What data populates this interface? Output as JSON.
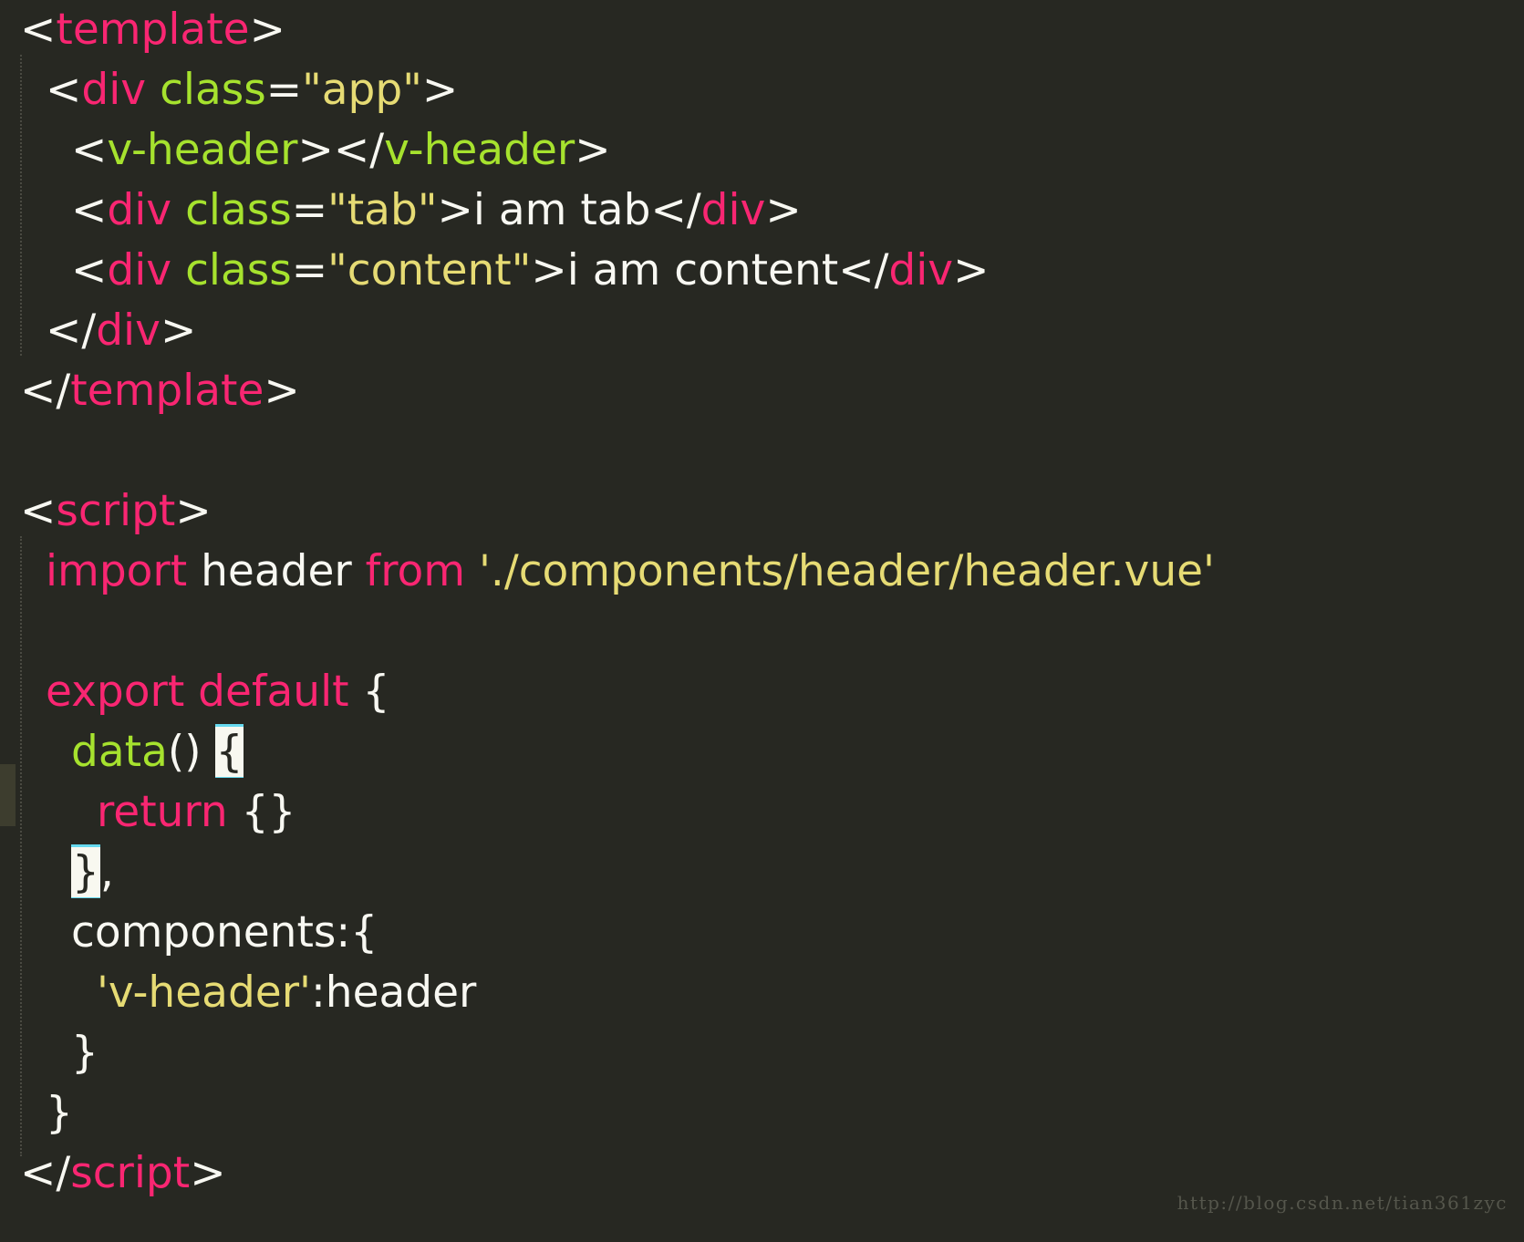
{
  "editor": {
    "theme_name": "monokai",
    "language": "vue",
    "background_color": "#272822",
    "foreground_color": "#f8f8f2",
    "tag_color": "#f92672",
    "attr_color": "#a6e22e",
    "string_color": "#e6db74",
    "bracket_highlight_color": "#f8f8f0",
    "bracket_highlight_border_color": "#66d9ef",
    "indent_guide_color": "#4a4a42",
    "marker_bar_color": "#3d3d2e"
  },
  "code_lines": [
    {
      "indent": 0,
      "tokens": [
        {
          "t": "<",
          "c": "punc"
        },
        {
          "t": "template",
          "c": "tag"
        },
        {
          "t": ">",
          "c": "punc"
        }
      ]
    },
    {
      "indent": 1,
      "tokens": [
        {
          "t": "<",
          "c": "punc"
        },
        {
          "t": "div",
          "c": "tag"
        },
        {
          "t": " ",
          "c": "text"
        },
        {
          "t": "class",
          "c": "attr"
        },
        {
          "t": "=",
          "c": "punc"
        },
        {
          "t": "\"app\"",
          "c": "str"
        },
        {
          "t": ">",
          "c": "punc"
        }
      ]
    },
    {
      "indent": 2,
      "tokens": [
        {
          "t": "<",
          "c": "punc"
        },
        {
          "t": "v-header",
          "c": "attr"
        },
        {
          "t": ">",
          "c": "punc"
        },
        {
          "t": "</",
          "c": "punc"
        },
        {
          "t": "v-header",
          "c": "attr"
        },
        {
          "t": ">",
          "c": "punc"
        }
      ]
    },
    {
      "indent": 2,
      "tokens": [
        {
          "t": "<",
          "c": "punc"
        },
        {
          "t": "div",
          "c": "tag"
        },
        {
          "t": " ",
          "c": "text"
        },
        {
          "t": "class",
          "c": "attr"
        },
        {
          "t": "=",
          "c": "punc"
        },
        {
          "t": "\"tab\"",
          "c": "str"
        },
        {
          "t": ">",
          "c": "punc"
        },
        {
          "t": "i am tab",
          "c": "text"
        },
        {
          "t": "</",
          "c": "punc"
        },
        {
          "t": "div",
          "c": "tag"
        },
        {
          "t": ">",
          "c": "punc"
        }
      ]
    },
    {
      "indent": 2,
      "tokens": [
        {
          "t": "<",
          "c": "punc"
        },
        {
          "t": "div",
          "c": "tag"
        },
        {
          "t": " ",
          "c": "text"
        },
        {
          "t": "class",
          "c": "attr"
        },
        {
          "t": "=",
          "c": "punc"
        },
        {
          "t": "\"content\"",
          "c": "str"
        },
        {
          "t": ">",
          "c": "punc"
        },
        {
          "t": "i am content",
          "c": "text"
        },
        {
          "t": "</",
          "c": "punc"
        },
        {
          "t": "div",
          "c": "tag"
        },
        {
          "t": ">",
          "c": "punc"
        }
      ]
    },
    {
      "indent": 1,
      "tokens": [
        {
          "t": "</",
          "c": "punc"
        },
        {
          "t": "div",
          "c": "tag"
        },
        {
          "t": ">",
          "c": "punc"
        }
      ]
    },
    {
      "indent": 0,
      "tokens": [
        {
          "t": "</",
          "c": "punc"
        },
        {
          "t": "template",
          "c": "tag"
        },
        {
          "t": ">",
          "c": "punc"
        }
      ]
    },
    {
      "indent": 0,
      "tokens": []
    },
    {
      "indent": 0,
      "tokens": [
        {
          "t": "<",
          "c": "punc"
        },
        {
          "t": "script",
          "c": "tag"
        },
        {
          "t": ">",
          "c": "punc"
        }
      ]
    },
    {
      "indent": 1,
      "tokens": [
        {
          "t": "import",
          "c": "tag"
        },
        {
          "t": " header ",
          "c": "text"
        },
        {
          "t": "from",
          "c": "tag"
        },
        {
          "t": " ",
          "c": "text"
        },
        {
          "t": "'./components/header/header.vue'",
          "c": "str"
        }
      ]
    },
    {
      "indent": 0,
      "tokens": []
    },
    {
      "indent": 1,
      "tokens": [
        {
          "t": "export default",
          "c": "tag"
        },
        {
          "t": " {",
          "c": "punc"
        }
      ]
    },
    {
      "indent": 2,
      "tokens": [
        {
          "t": "data",
          "c": "attr"
        },
        {
          "t": "()",
          "c": "punc"
        },
        {
          "t": " ",
          "c": "text"
        },
        {
          "t": "{",
          "c": "punc",
          "hl": true
        }
      ]
    },
    {
      "indent": 3,
      "tokens": [
        {
          "t": "return",
          "c": "tag"
        },
        {
          "t": " {}",
          "c": "punc"
        }
      ]
    },
    {
      "indent": 2,
      "tokens": [
        {
          "t": "}",
          "c": "punc",
          "hl": true
        },
        {
          "t": ",",
          "c": "punc"
        }
      ]
    },
    {
      "indent": 2,
      "tokens": [
        {
          "t": "components",
          "c": "text"
        },
        {
          "t": ":{",
          "c": "punc"
        }
      ]
    },
    {
      "indent": 3,
      "tokens": [
        {
          "t": "'v-header'",
          "c": "str"
        },
        {
          "t": ":",
          "c": "punc"
        },
        {
          "t": "header",
          "c": "text"
        }
      ]
    },
    {
      "indent": 2,
      "tokens": [
        {
          "t": "}",
          "c": "punc"
        }
      ]
    },
    {
      "indent": 1,
      "tokens": [
        {
          "t": "}",
          "c": "punc"
        }
      ]
    },
    {
      "indent": 0,
      "tokens": [
        {
          "t": "</",
          "c": "punc"
        },
        {
          "t": "script",
          "c": "tag"
        },
        {
          "t": ">",
          "c": "punc"
        }
      ]
    }
  ],
  "watermark": {
    "text": "http://blog.csdn.net/tian361zyc"
  }
}
